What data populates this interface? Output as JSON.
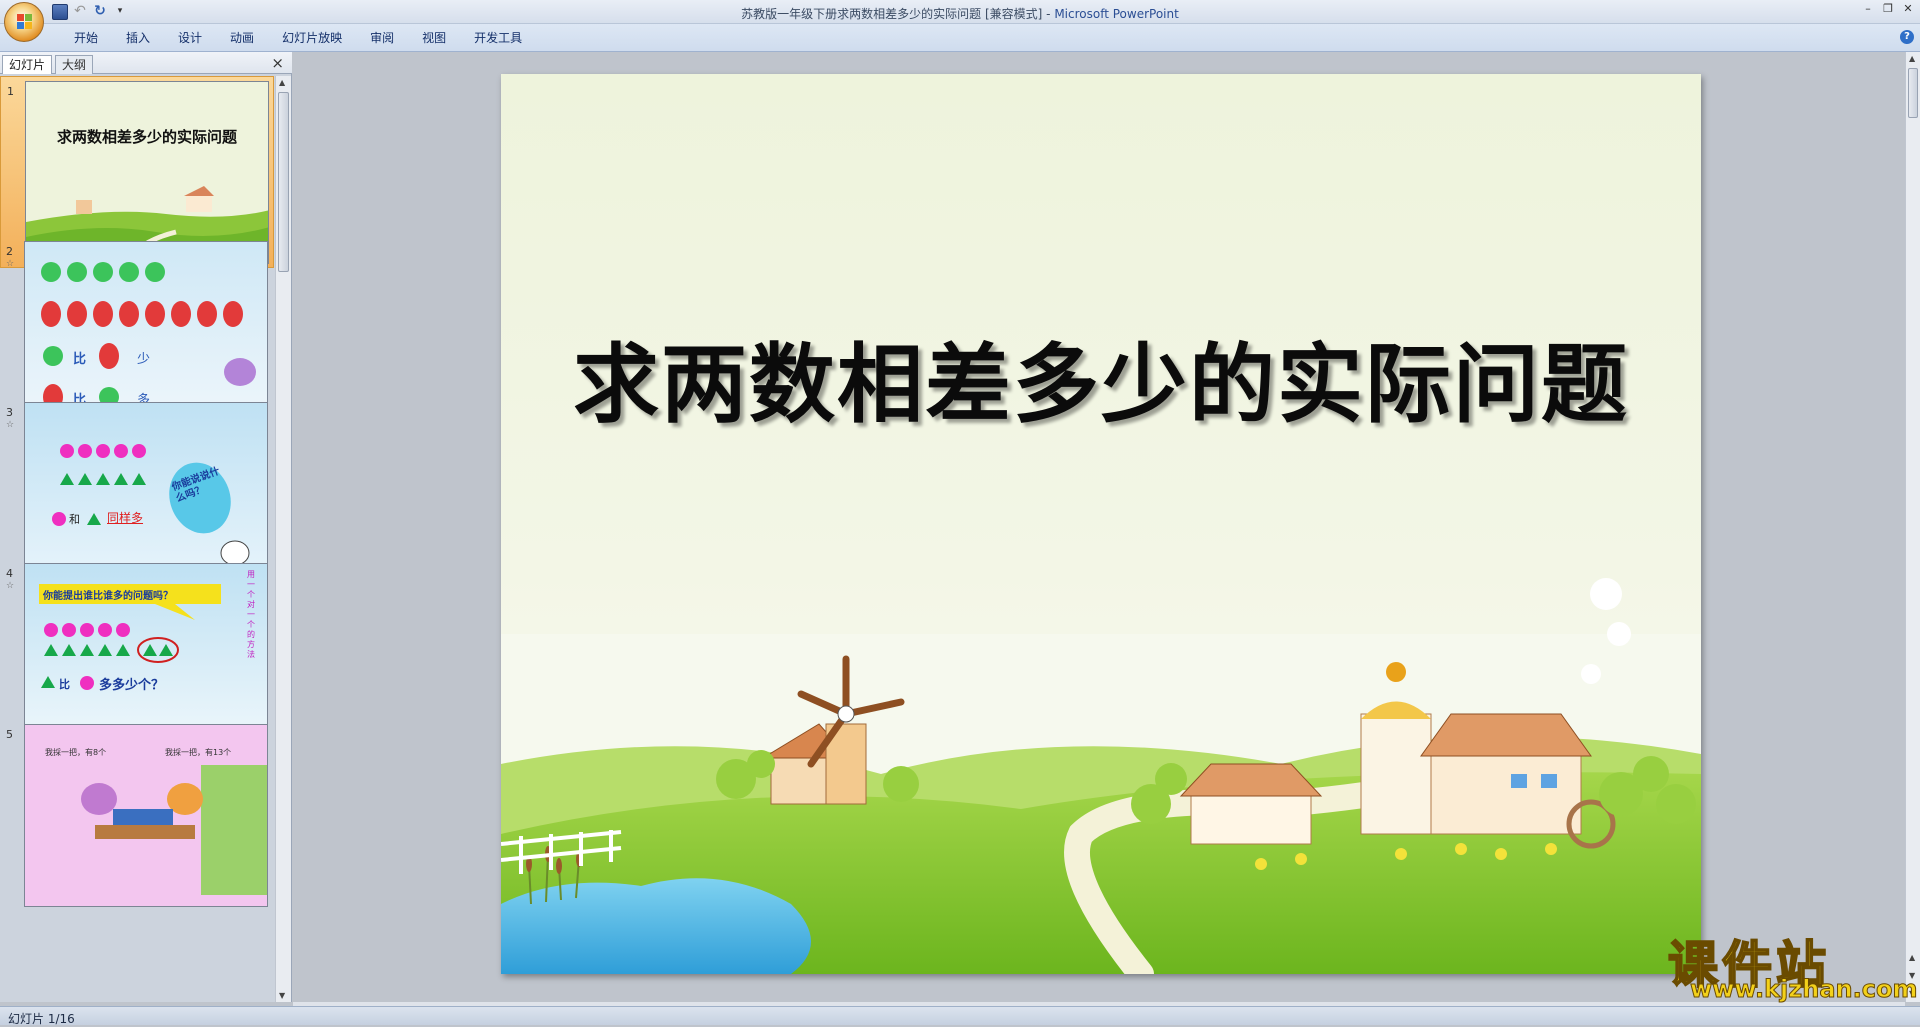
{
  "window": {
    "title": "苏教版一年级下册求两数相差多少的实际问题 [兼容模式]",
    "app_name": "Microsoft PowerPoint",
    "separator": " - "
  },
  "ribbon": {
    "tabs": [
      "开始",
      "插入",
      "设计",
      "动画",
      "幻灯片放映",
      "审阅",
      "视图",
      "开发工具"
    ]
  },
  "left_pane": {
    "tab_slides": "幻灯片",
    "tab_outline": "大纲",
    "close_glyph": "×",
    "thumbnails": [
      {
        "num": "1",
        "title": "求两数相差多少的实际问题"
      },
      {
        "num": "2",
        "line1": "比",
        "line1b": "少",
        "line2": "比",
        "line2b": "多"
      },
      {
        "num": "3",
        "row": "和",
        "rowb": "同样多",
        "bubble": "你能说说什么吗？"
      },
      {
        "num": "4",
        "bubble": "你能提出谁比谁多的问题吗？",
        "row": "比",
        "rowb": "多多少个？",
        "side": "用一个对一个的方法"
      },
      {
        "num": "5",
        "left": "我採一把，有8个",
        "right": "我採一把，有13个"
      }
    ]
  },
  "slide": {
    "title": "求两数相差多少的实际问题"
  },
  "status": {
    "text": "幻灯片 1/16"
  },
  "watermark": {
    "main": "课件站",
    "url": "www.kjzhan.com"
  },
  "colors": {
    "accent": "#2b4e94",
    "selected_thumb": "#f3b05a",
    "watermark": "#f3d11a"
  }
}
